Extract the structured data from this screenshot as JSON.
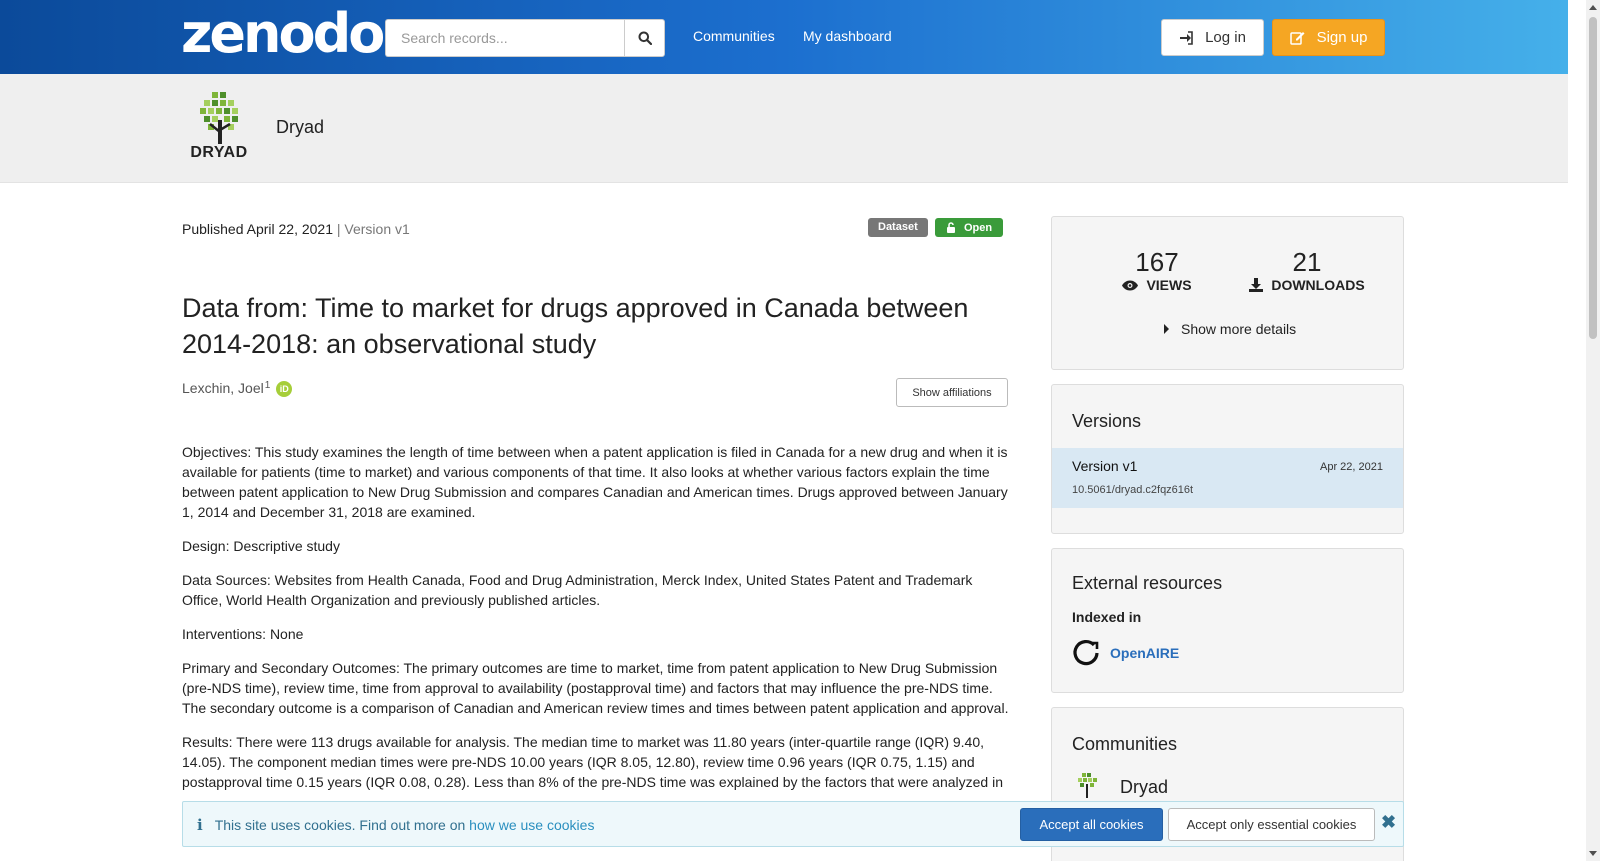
{
  "header": {
    "logo_text": "zenodo",
    "search_placeholder": "Search records...",
    "nav": [
      "Communities",
      "My dashboard"
    ],
    "login_label": "Log in",
    "signup_label": "Sign up"
  },
  "community_header": {
    "logo_text": "DRYAD",
    "name": "Dryad"
  },
  "record": {
    "published": "Published April 22, 2021",
    "version": "Version v1",
    "type_badge": "Dataset",
    "access_badge": "Open",
    "title": "Data from: Time to market for drugs approved in Canada between 2014-2018: an observational study",
    "author": "Lexchin, Joel",
    "author_affiliation_index": "1",
    "show_affiliations_label": "Show affiliations",
    "description": [
      "Objectives: This study examines the length of time between when a patent application is filed in Canada for a new drug and when it is available for patients (time to market) and various components of that time. It also looks at whether various factors explain the time between patent application to New Drug Submission and compares Canadian and American times. Drugs approved between January 1, 2014 and December 31, 2018 are examined.",
      "Design: Descriptive study",
      "Data Sources: Websites from Health Canada, Food and Drug Administration, Merck Index, United States Patent and Trademark Office, World Health Organization and previously published articles.",
      "Interventions: None",
      "Primary and Secondary Outcomes: The primary outcomes are time to market, time from patent application to New Drug Submission (pre-NDS time), review time, time from approval to availability (postapproval time) and factors that may influence the pre-NDS time. The secondary outcome is a comparison of Canadian and American review times and times between patent application and approval.",
      "Results: There were 113 drugs available for analysis. The median time to market was 11.80 years (inter-quartile range (IQR) 9.40, 14.05). The component median times were pre-NDS 10.00 years (IQR 8.05, 12.80), review time 0.96 years (IQR 0.75, 1.15) and postapproval time 0.15 years (IQR 0.08, 0.28). Less than 8% of the pre-NDS time was explained by the factors that were analyzed in"
    ]
  },
  "stats": {
    "views": "167",
    "views_label": "VIEWS",
    "downloads": "21",
    "downloads_label": "DOWNLOADS",
    "more_label": "Show more details"
  },
  "versions": {
    "heading": "Versions",
    "items": [
      {
        "name": "Version v1",
        "date": "Apr 22, 2021",
        "doi": "10.5061/dryad.c2fqz616t"
      }
    ]
  },
  "external": {
    "heading": "External resources",
    "indexed_label": "Indexed in",
    "resource": "OpenAIRE"
  },
  "communities": {
    "heading": "Communities",
    "items": [
      "Dryad"
    ]
  },
  "cookie": {
    "text": "This site uses cookies. Find out more on",
    "link": "how we use cookies",
    "accept_all": "Accept all cookies",
    "accept_essential": "Accept only essential cookies"
  },
  "colors": {
    "header_start": "#0b4a9a",
    "header_end": "#45b0ea",
    "signup": "#f5a623",
    "open_badge": "#3a9b3a",
    "link": "#2a6ebb"
  }
}
